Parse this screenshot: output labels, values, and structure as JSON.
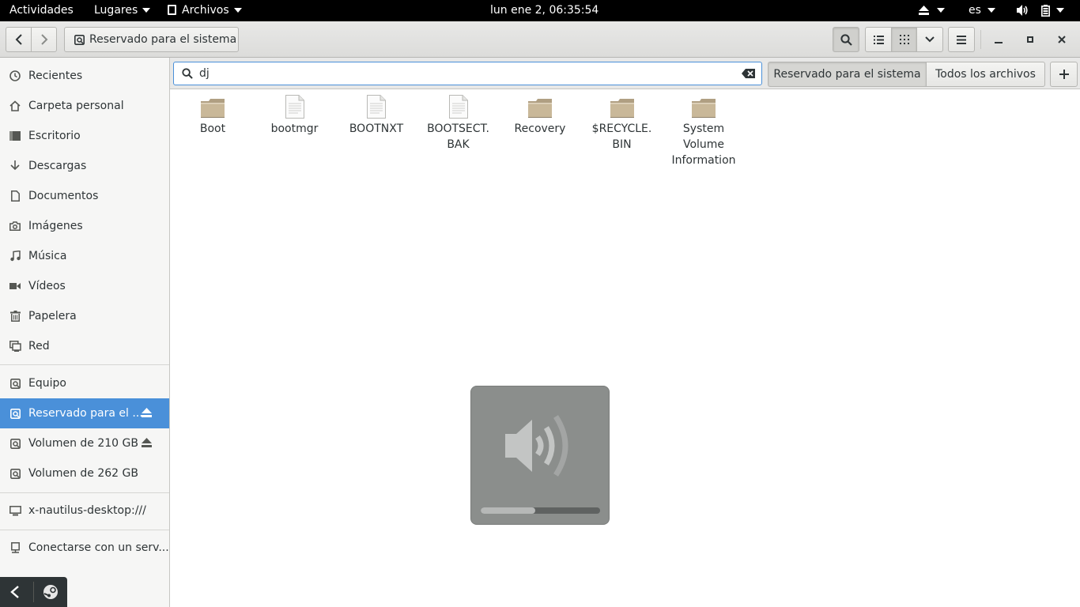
{
  "topbar": {
    "activities": "Actividades",
    "places": "Lugares",
    "app_menu": "Archivos",
    "clock": "lun ene  2, 06:35:54",
    "language": "es"
  },
  "header": {
    "location": "Reservado para el sistema"
  },
  "sidebar": {
    "items": [
      {
        "label": "Recientes",
        "icon": "clock-icon"
      },
      {
        "label": "Carpeta personal",
        "icon": "home-icon"
      },
      {
        "label": "Escritorio",
        "icon": "desktop-icon"
      },
      {
        "label": "Descargas",
        "icon": "download-icon"
      },
      {
        "label": "Documentos",
        "icon": "document-icon"
      },
      {
        "label": "Imágenes",
        "icon": "camera-icon"
      },
      {
        "label": "Música",
        "icon": "music-icon"
      },
      {
        "label": "Vídeos",
        "icon": "video-icon"
      },
      {
        "label": "Papelera",
        "icon": "trash-icon"
      },
      {
        "label": "Red",
        "icon": "network-icon"
      }
    ],
    "devices": [
      {
        "label": "Equipo",
        "icon": "drive-icon"
      },
      {
        "label": "Reservado para el ...",
        "icon": "drive-icon",
        "selected": true,
        "eject": true
      },
      {
        "label": "Volumen de 210 GB",
        "icon": "drive-icon",
        "eject": true
      },
      {
        "label": "Volumen de 262 GB",
        "icon": "drive-icon"
      }
    ],
    "bookmark": {
      "label": "x-nautilus-desktop:///",
      "icon": "computer-icon"
    },
    "connect": {
      "label": "Conectarse con un serv...",
      "icon": "server-icon"
    }
  },
  "search": {
    "value": "dj",
    "scope_current": "Reservado para el sistema",
    "scope_all": "Todos los archivos"
  },
  "files": [
    {
      "name": "Boot",
      "type": "folder"
    },
    {
      "name": "bootmgr",
      "type": "file"
    },
    {
      "name": "BOOTNXT",
      "type": "file"
    },
    {
      "name": "BOOTSECT.\nBAK",
      "type": "file"
    },
    {
      "name": "Recovery",
      "type": "folder"
    },
    {
      "name": "$RECYCLE.\nBIN",
      "type": "folder"
    },
    {
      "name": "System\nVolume\nInformation",
      "type": "folder"
    }
  ],
  "osd": {
    "icon": "speaker-volume-icon",
    "volume_fraction": 0.46
  },
  "colors": {
    "accent": "#4a90d9",
    "folder": "#c9b899"
  }
}
